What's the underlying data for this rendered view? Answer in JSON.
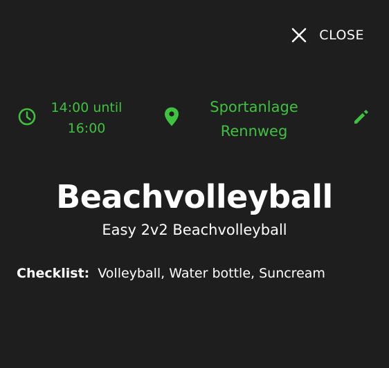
{
  "close": {
    "label": "CLOSE",
    "icon": "close-icon"
  },
  "event": {
    "time": {
      "line1": "14:00 until",
      "line2": "16:00",
      "icon": "clock-icon"
    },
    "location": {
      "line1": "Sportanlage",
      "line2": "Rennweg",
      "icon": "location-pin-icon"
    },
    "edit_icon": "pencil-icon",
    "title": "Beachvolleyball",
    "subtitle": "Easy 2v2 Beachvolleyball",
    "checklist": {
      "label": "Checklist:",
      "items": "Volleyball, Water bottle, Suncream"
    }
  },
  "colors": {
    "background": "#1e1e1e",
    "accent": "#3fc23f",
    "text": "#ffffff"
  }
}
